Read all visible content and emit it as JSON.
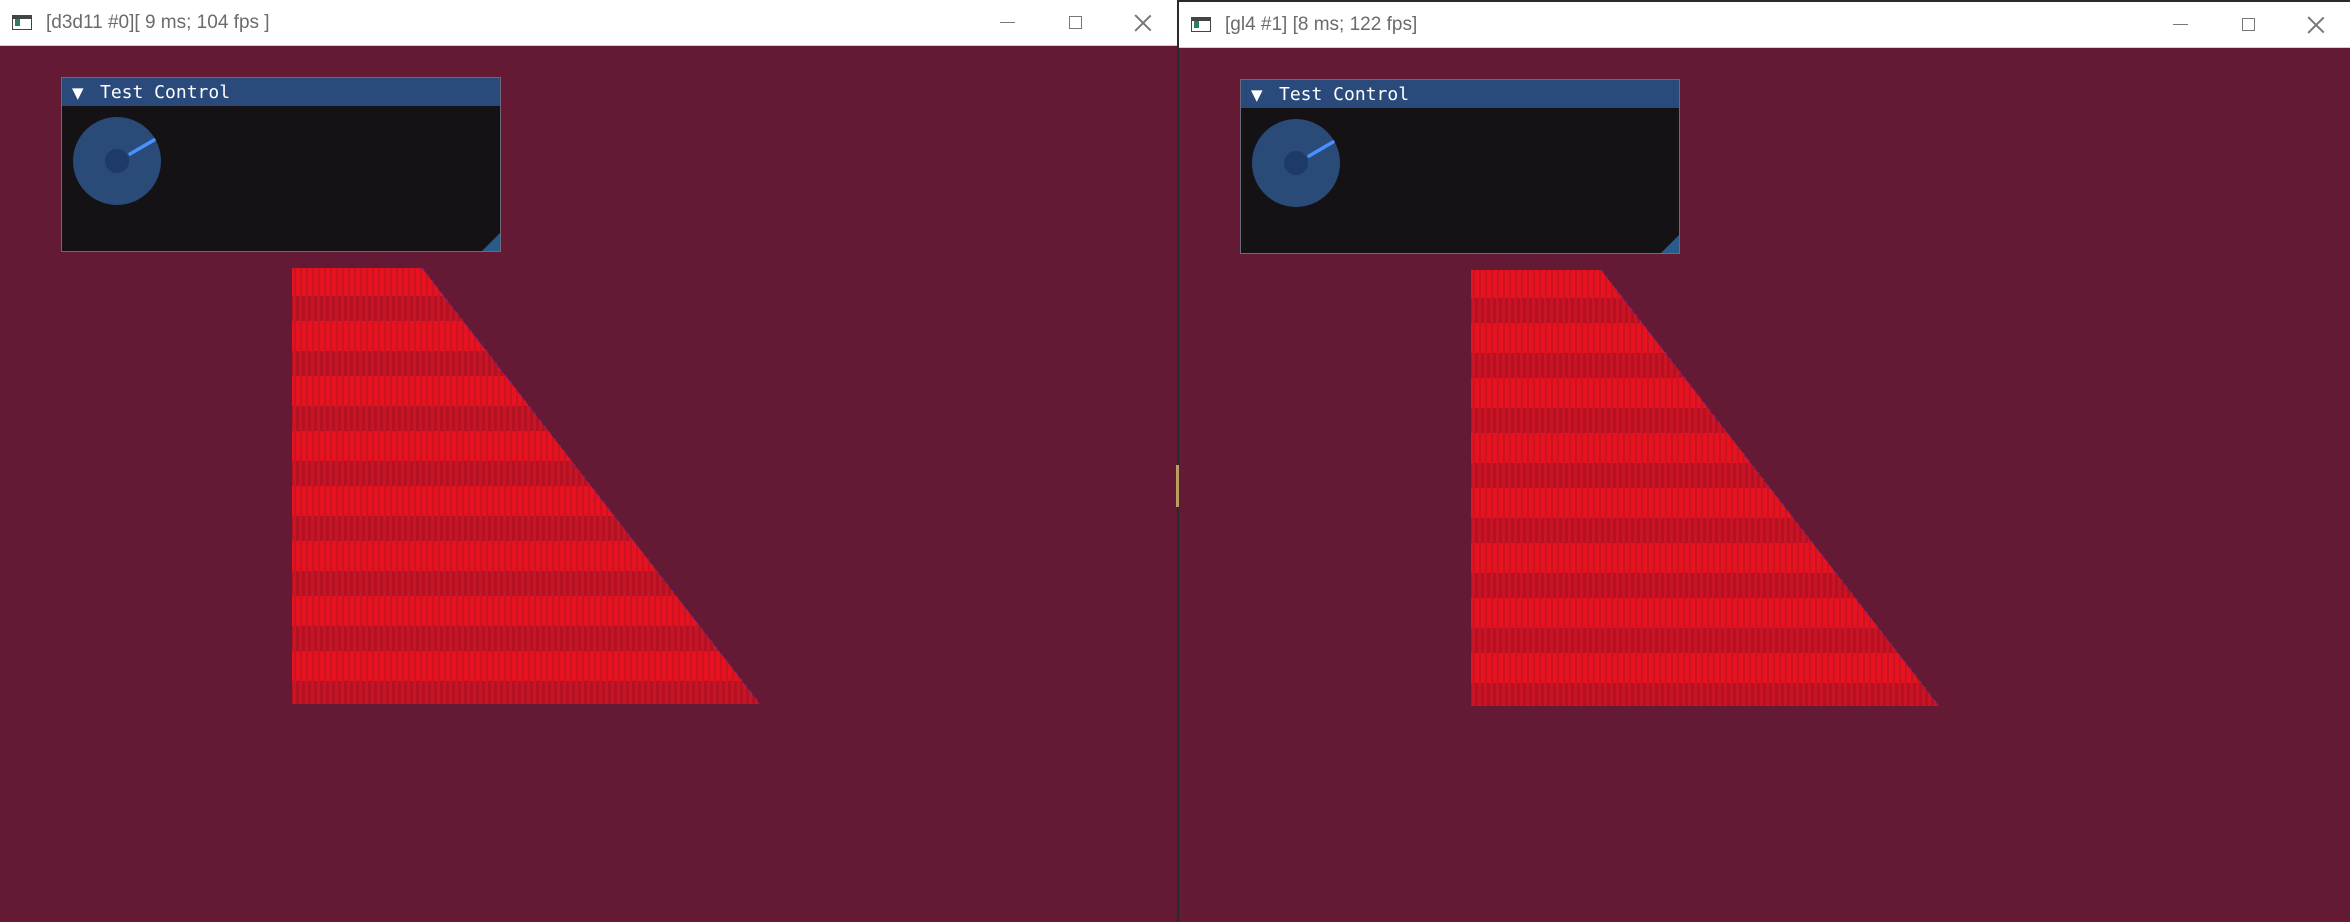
{
  "windows": [
    {
      "title": "[d3d11 #0][ 9 ms; 104 fps ]",
      "panel": {
        "title": "Test Control",
        "collapse_arrow": "▼"
      }
    },
    {
      "title": "[gl4 #1] [8 ms; 122 fps]",
      "panel": {
        "title": "Test Control",
        "collapse_arrow": "▼"
      }
    }
  ],
  "colors": {
    "window_background": "#641a34",
    "shape_fill": "#e0121f",
    "shape_stripe": "#b01222",
    "panel_header": "#294a7a",
    "panel_body": "#141214",
    "knob": "#2a4a78",
    "knob_needle": "#4a90ff"
  },
  "icons": {
    "app": "app-window-icon",
    "minimize": "minimize-icon",
    "maximize": "maximize-icon",
    "close": "close-icon"
  }
}
